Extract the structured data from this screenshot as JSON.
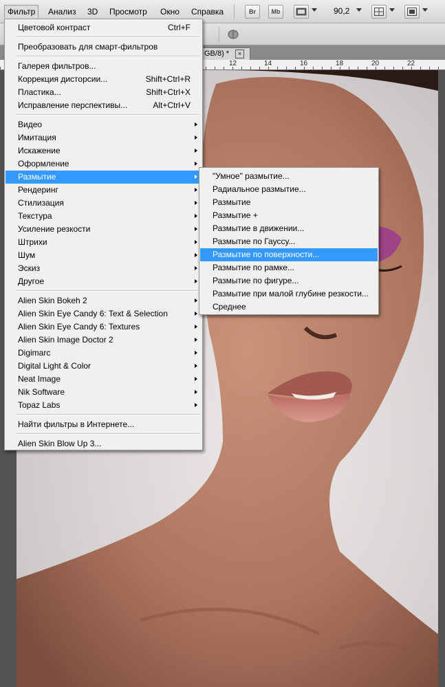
{
  "menubar": {
    "items": [
      "Фильтр",
      "Анализ",
      "3D",
      "Просмотр",
      "Окно",
      "Справка"
    ],
    "buttons": {
      "bridge": "Br",
      "minibridge": "Mb"
    },
    "zoom": "90,2"
  },
  "document_tab": {
    "label": "GB/8) *",
    "close": "×"
  },
  "ruler": {
    "labels": [
      "12",
      "14",
      "16",
      "18",
      "20",
      "22"
    ]
  },
  "filter_menu": {
    "items": [
      {
        "label": "Цветовой контраст",
        "shortcut": "Ctrl+F"
      },
      {
        "label": "Преобразовать для смарт-фильтров"
      },
      {
        "label": "Галерея фильтров..."
      },
      {
        "label": "Коррекция дисторсии...",
        "shortcut": "Shift+Ctrl+R"
      },
      {
        "label": "Пластика...",
        "shortcut": "Shift+Ctrl+X"
      },
      {
        "label": "Исправление перспективы...",
        "shortcut": "Alt+Ctrl+V"
      },
      {
        "label": "Видео"
      },
      {
        "label": "Имитация"
      },
      {
        "label": "Искажение"
      },
      {
        "label": "Оформление"
      },
      {
        "label": "Размытие"
      },
      {
        "label": "Рендеринг"
      },
      {
        "label": "Стилизация"
      },
      {
        "label": "Текстура"
      },
      {
        "label": "Усиление резкости"
      },
      {
        "label": "Штрихи"
      },
      {
        "label": "Шум"
      },
      {
        "label": "Эскиз"
      },
      {
        "label": "Другое"
      },
      {
        "label": "Alien Skin Bokeh 2"
      },
      {
        "label": "Alien Skin Eye Candy 6: Text & Selection"
      },
      {
        "label": "Alien Skin Eye Candy 6: Textures"
      },
      {
        "label": "Alien Skin Image Doctor 2"
      },
      {
        "label": "Digimarc"
      },
      {
        "label": "Digital Light & Color"
      },
      {
        "label": "Neat Image"
      },
      {
        "label": "Nik Software"
      },
      {
        "label": "Topaz Labs"
      },
      {
        "label": "Найти фильтры в Интернете..."
      },
      {
        "label": "Alien Skin Blow Up 3..."
      }
    ]
  },
  "blur_submenu": {
    "items": [
      "\"Умное\" размытие...",
      "Радиальное размытие...",
      "Размытие",
      "Размытие +",
      "Размытие в движении...",
      "Размытие по Гауссу...",
      "Размытие по поверхности...",
      "Размытие по рамке...",
      "Размытие по фигуре...",
      "Размытие при малой глубине резкости...",
      "Среднее"
    ]
  },
  "colors": {
    "highlight": "#3399ff",
    "menu_bg": "#f0f0f0"
  }
}
